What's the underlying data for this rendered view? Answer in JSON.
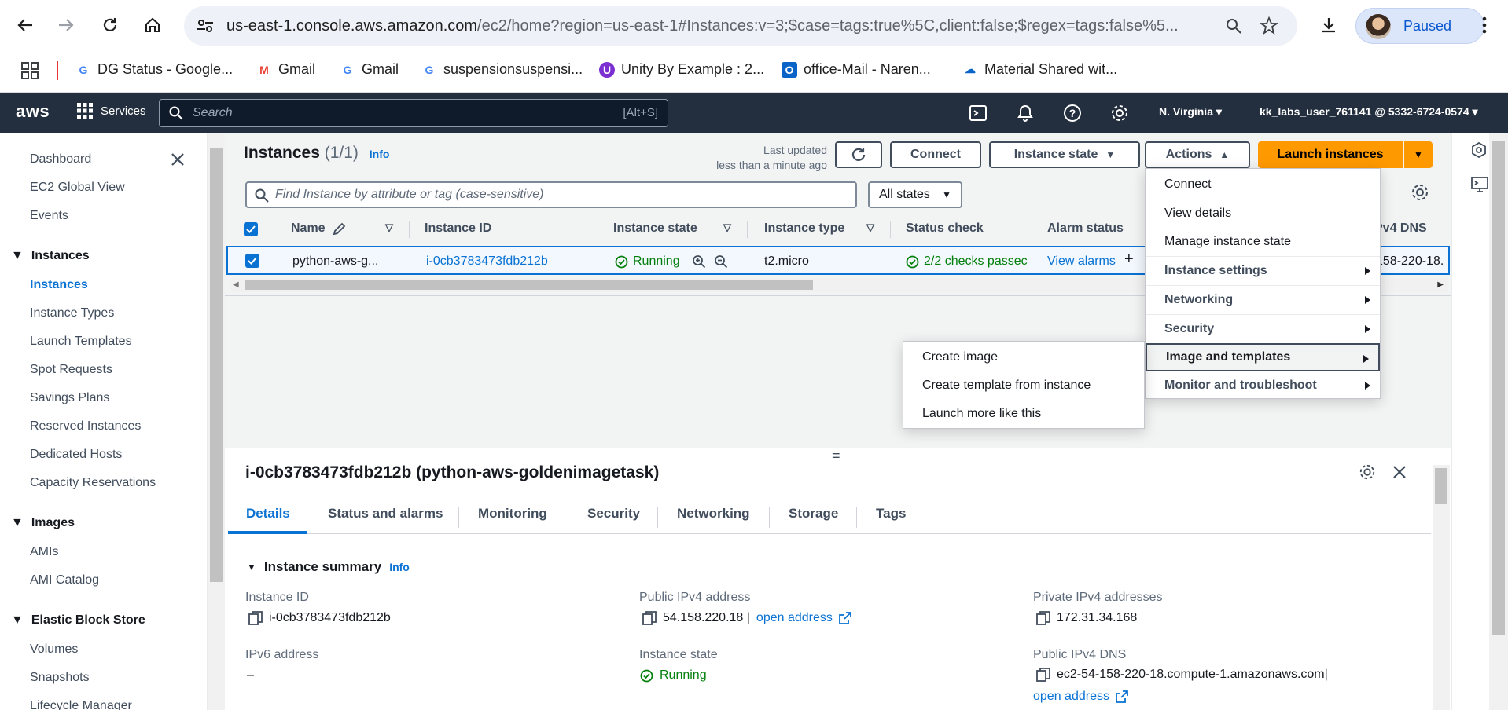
{
  "browser": {
    "url_host": "us-east-1.console.aws.amazon.com",
    "url_path": "/ec2/home?region=us-east-1#Instances:v=3;$case=tags:true%5C,client:false;$regex=tags:false%5...",
    "profile_status": "Paused",
    "bookmarks": [
      {
        "label": "DG Status - Google..."
      },
      {
        "label": "Gmail"
      },
      {
        "label": "Gmail"
      },
      {
        "label": "suspensionsuspensi..."
      },
      {
        "label": "Unity By Example : 2..."
      },
      {
        "label": "office-Mail - Naren..."
      },
      {
        "label": "Material Shared wit..."
      }
    ]
  },
  "aws": {
    "logo": "aws",
    "services_label": "Services",
    "search_placeholder": "Search",
    "search_shortcut": "[Alt+S]",
    "region": "N. Virginia",
    "account": "kk_labs_user_761141 @ 5332-6724-0574"
  },
  "sidebar": {
    "top_items": [
      "Dashboard",
      "EC2 Global View",
      "Events"
    ],
    "sections": [
      {
        "title": "Instances",
        "items": [
          "Instances",
          "Instance Types",
          "Launch Templates",
          "Spot Requests",
          "Savings Plans",
          "Reserved Instances",
          "Dedicated Hosts",
          "Capacity Reservations"
        ]
      },
      {
        "title": "Images",
        "items": [
          "AMIs",
          "AMI Catalog"
        ]
      },
      {
        "title": "Elastic Block Store",
        "items": [
          "Volumes",
          "Snapshots",
          "Lifecycle Manager"
        ]
      }
    ],
    "active_item": "Instances"
  },
  "instances": {
    "title": "Instances",
    "count": "(1/1)",
    "info": "Info",
    "last_updated_label": "Last updated",
    "last_updated_value": "less than a minute ago",
    "buttons": {
      "connect": "Connect",
      "instance_state": "Instance state",
      "actions": "Actions",
      "launch": "Launch instances"
    },
    "filter_placeholder": "Find Instance by attribute or tag (case-sensitive)",
    "states_filter": "All states",
    "columns": [
      "Name",
      "Instance ID",
      "Instance state",
      "Instance type",
      "Status check",
      "Alarm status",
      "Pv4 DNS"
    ],
    "row": {
      "name": "python-aws-g...",
      "instance_id": "i-0cb3783473fdb212b",
      "state": "Running",
      "type": "t2.micro",
      "status_check": "2/2 checks passec",
      "alarm": "View alarms",
      "dns": "158-220-18."
    }
  },
  "actions_menu": {
    "items": [
      {
        "label": "Connect",
        "submenu": false
      },
      {
        "label": "View details",
        "submenu": false
      },
      {
        "label": "Manage instance state",
        "submenu": false
      },
      {
        "label": "Instance settings",
        "submenu": true
      },
      {
        "label": "Networking",
        "submenu": true
      },
      {
        "label": "Security",
        "submenu": true
      },
      {
        "label": "Image and templates",
        "submenu": true
      },
      {
        "label": "Monitor and troubleshoot",
        "submenu": true
      }
    ]
  },
  "image_submenu": {
    "items": [
      "Create image",
      "Create template from instance",
      "Launch more like this"
    ]
  },
  "detail": {
    "title": "i-0cb3783473fdb212b (python-aws-goldenimagetask)",
    "tabs": [
      "Details",
      "Status and alarms",
      "Monitoring",
      "Security",
      "Networking",
      "Storage",
      "Tags"
    ],
    "section_title": "Instance summary",
    "section_info": "Info",
    "fields": {
      "instance_id_label": "Instance ID",
      "instance_id_value": "i-0cb3783473fdb212b",
      "public_ipv4_label": "Public IPv4 address",
      "public_ipv4_value": "54.158.220.18 |",
      "open_address": "open address",
      "private_ipv4_label": "Private IPv4 addresses",
      "private_ipv4_value": "172.31.34.168",
      "ipv6_label": "IPv6 address",
      "ipv6_value": "–",
      "state_label": "Instance state",
      "state_value": "Running",
      "public_dns_label": "Public IPv4 DNS",
      "public_dns_value": "ec2-54-158-220-18.compute-1.amazonaws.com|",
      "open_address_2": "open address"
    }
  },
  "colors": {
    "aws_nav": "#232f3e",
    "link": "#0972d3",
    "primary": "#ff9900",
    "success": "#037f0c"
  }
}
